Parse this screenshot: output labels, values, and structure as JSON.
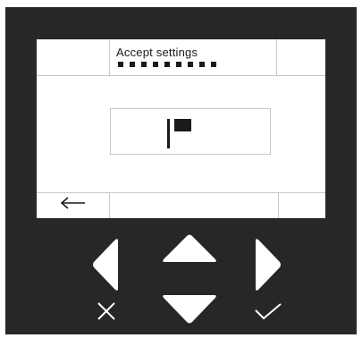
{
  "screen": {
    "title": "Accept settings",
    "progress_total": 9,
    "progress_filled": 9
  },
  "value_field": {
    "content": "cursor-with-flag"
  },
  "bottom_bar": {
    "left_icon": "back-arrow-icon"
  },
  "keypad": {
    "left_icon": "triangle-left-icon",
    "up_icon": "triangle-up-icon",
    "down_icon": "triangle-down-icon",
    "right_icon": "triangle-right-icon",
    "cancel_icon": "cancel-x-icon",
    "confirm_icon": "confirm-check-icon"
  },
  "colors": {
    "device_body": "#262729",
    "screen_bg": "#ffffff",
    "screen_ink": "#1a1a1a",
    "key_fill": "#ffffff",
    "grid_line": "#c8c8c8"
  }
}
